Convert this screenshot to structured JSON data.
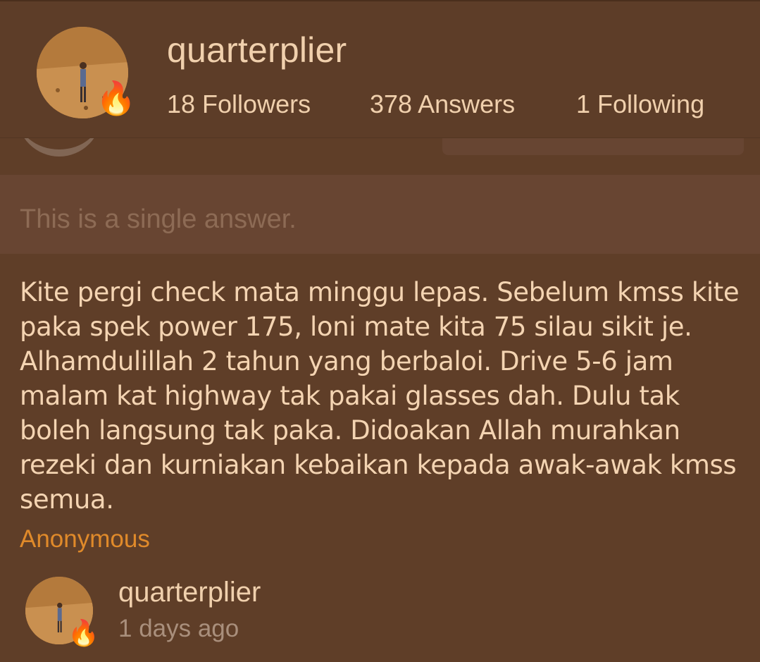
{
  "profile": {
    "username": "quarterplier",
    "followers": "18 Followers",
    "answers": "378 Answers",
    "following": "1 Following",
    "badge_icon": "fire-icon"
  },
  "notice": "This is a single answer.",
  "answer_text": "Kite pergi check mata minggu lepas. Sebelum kmss kite paka spek power 175, loni mate kita 75 silau sikit je. Alhamdulillah 2 tahun yang berbaloi. Drive 5-6 jam malam kat highway tak pakai glasses dah. Dulu tak boleh langsung tak paka. Didoakan Allah murahkan rezeki dan kurniakan kebaikan kepada awak-awak kmss semua.",
  "asker": "Anonymous",
  "responder": {
    "username": "quarterplier",
    "time": "1 days ago"
  },
  "colors": {
    "background": "#5f3e28",
    "text": "#f4d4b2",
    "accent": "#e08a2a",
    "muted": "#a98f7c"
  }
}
